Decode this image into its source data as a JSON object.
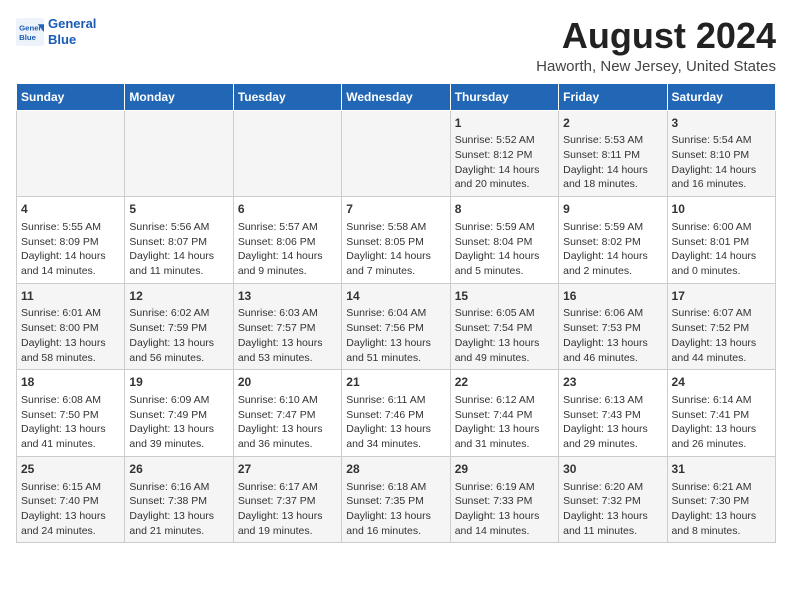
{
  "header": {
    "logo_line1": "General",
    "logo_line2": "Blue",
    "title": "August 2024",
    "subtitle": "Haworth, New Jersey, United States"
  },
  "days_of_week": [
    "Sunday",
    "Monday",
    "Tuesday",
    "Wednesday",
    "Thursday",
    "Friday",
    "Saturday"
  ],
  "weeks": [
    [
      {
        "day": "",
        "content": ""
      },
      {
        "day": "",
        "content": ""
      },
      {
        "day": "",
        "content": ""
      },
      {
        "day": "",
        "content": ""
      },
      {
        "day": "1",
        "content": "Sunrise: 5:52 AM\nSunset: 8:12 PM\nDaylight: 14 hours\nand 20 minutes."
      },
      {
        "day": "2",
        "content": "Sunrise: 5:53 AM\nSunset: 8:11 PM\nDaylight: 14 hours\nand 18 minutes."
      },
      {
        "day": "3",
        "content": "Sunrise: 5:54 AM\nSunset: 8:10 PM\nDaylight: 14 hours\nand 16 minutes."
      }
    ],
    [
      {
        "day": "4",
        "content": "Sunrise: 5:55 AM\nSunset: 8:09 PM\nDaylight: 14 hours\nand 14 minutes."
      },
      {
        "day": "5",
        "content": "Sunrise: 5:56 AM\nSunset: 8:07 PM\nDaylight: 14 hours\nand 11 minutes."
      },
      {
        "day": "6",
        "content": "Sunrise: 5:57 AM\nSunset: 8:06 PM\nDaylight: 14 hours\nand 9 minutes."
      },
      {
        "day": "7",
        "content": "Sunrise: 5:58 AM\nSunset: 8:05 PM\nDaylight: 14 hours\nand 7 minutes."
      },
      {
        "day": "8",
        "content": "Sunrise: 5:59 AM\nSunset: 8:04 PM\nDaylight: 14 hours\nand 5 minutes."
      },
      {
        "day": "9",
        "content": "Sunrise: 5:59 AM\nSunset: 8:02 PM\nDaylight: 14 hours\nand 2 minutes."
      },
      {
        "day": "10",
        "content": "Sunrise: 6:00 AM\nSunset: 8:01 PM\nDaylight: 14 hours\nand 0 minutes."
      }
    ],
    [
      {
        "day": "11",
        "content": "Sunrise: 6:01 AM\nSunset: 8:00 PM\nDaylight: 13 hours\nand 58 minutes."
      },
      {
        "day": "12",
        "content": "Sunrise: 6:02 AM\nSunset: 7:59 PM\nDaylight: 13 hours\nand 56 minutes."
      },
      {
        "day": "13",
        "content": "Sunrise: 6:03 AM\nSunset: 7:57 PM\nDaylight: 13 hours\nand 53 minutes."
      },
      {
        "day": "14",
        "content": "Sunrise: 6:04 AM\nSunset: 7:56 PM\nDaylight: 13 hours\nand 51 minutes."
      },
      {
        "day": "15",
        "content": "Sunrise: 6:05 AM\nSunset: 7:54 PM\nDaylight: 13 hours\nand 49 minutes."
      },
      {
        "day": "16",
        "content": "Sunrise: 6:06 AM\nSunset: 7:53 PM\nDaylight: 13 hours\nand 46 minutes."
      },
      {
        "day": "17",
        "content": "Sunrise: 6:07 AM\nSunset: 7:52 PM\nDaylight: 13 hours\nand 44 minutes."
      }
    ],
    [
      {
        "day": "18",
        "content": "Sunrise: 6:08 AM\nSunset: 7:50 PM\nDaylight: 13 hours\nand 41 minutes."
      },
      {
        "day": "19",
        "content": "Sunrise: 6:09 AM\nSunset: 7:49 PM\nDaylight: 13 hours\nand 39 minutes."
      },
      {
        "day": "20",
        "content": "Sunrise: 6:10 AM\nSunset: 7:47 PM\nDaylight: 13 hours\nand 36 minutes."
      },
      {
        "day": "21",
        "content": "Sunrise: 6:11 AM\nSunset: 7:46 PM\nDaylight: 13 hours\nand 34 minutes."
      },
      {
        "day": "22",
        "content": "Sunrise: 6:12 AM\nSunset: 7:44 PM\nDaylight: 13 hours\nand 31 minutes."
      },
      {
        "day": "23",
        "content": "Sunrise: 6:13 AM\nSunset: 7:43 PM\nDaylight: 13 hours\nand 29 minutes."
      },
      {
        "day": "24",
        "content": "Sunrise: 6:14 AM\nSunset: 7:41 PM\nDaylight: 13 hours\nand 26 minutes."
      }
    ],
    [
      {
        "day": "25",
        "content": "Sunrise: 6:15 AM\nSunset: 7:40 PM\nDaylight: 13 hours\nand 24 minutes."
      },
      {
        "day": "26",
        "content": "Sunrise: 6:16 AM\nSunset: 7:38 PM\nDaylight: 13 hours\nand 21 minutes."
      },
      {
        "day": "27",
        "content": "Sunrise: 6:17 AM\nSunset: 7:37 PM\nDaylight: 13 hours\nand 19 minutes."
      },
      {
        "day": "28",
        "content": "Sunrise: 6:18 AM\nSunset: 7:35 PM\nDaylight: 13 hours\nand 16 minutes."
      },
      {
        "day": "29",
        "content": "Sunrise: 6:19 AM\nSunset: 7:33 PM\nDaylight: 13 hours\nand 14 minutes."
      },
      {
        "day": "30",
        "content": "Sunrise: 6:20 AM\nSunset: 7:32 PM\nDaylight: 13 hours\nand 11 minutes."
      },
      {
        "day": "31",
        "content": "Sunrise: 6:21 AM\nSunset: 7:30 PM\nDaylight: 13 hours\nand 8 minutes."
      }
    ]
  ]
}
